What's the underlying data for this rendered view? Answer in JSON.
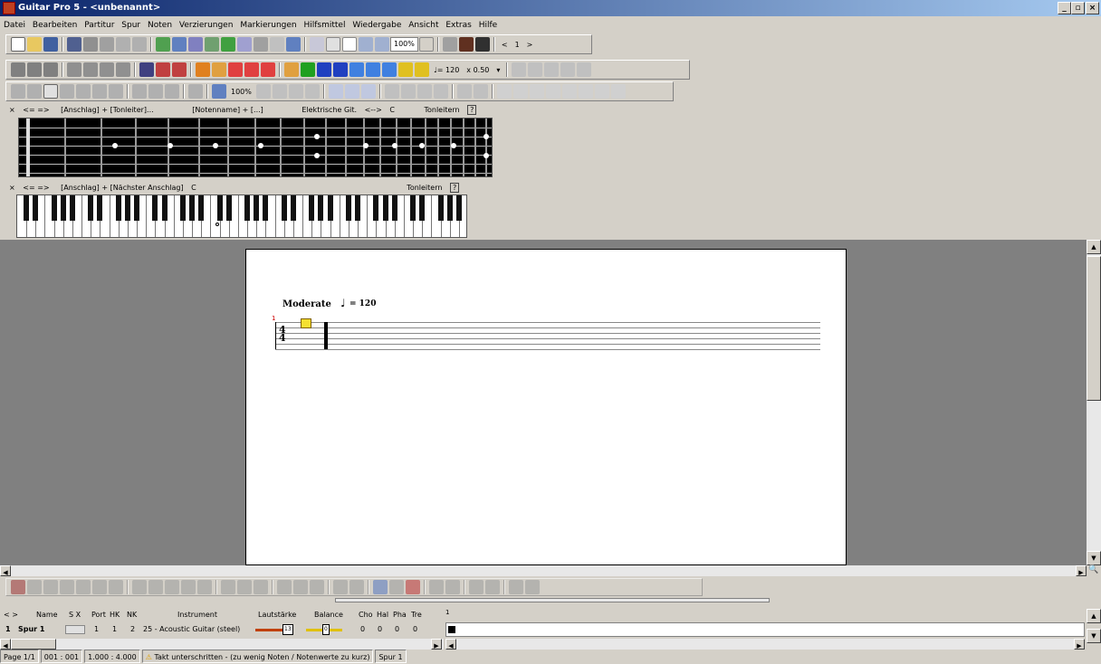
{
  "window": {
    "title": "Guitar Pro 5 - <unbenannt>",
    "min": "_",
    "max": "▫",
    "close": "×"
  },
  "menu": [
    "Datei",
    "Bearbeiten",
    "Partitur",
    "Spur",
    "Noten",
    "Verzierungen",
    "Markierungen",
    "Hilfsmittel",
    "Wiedergabe",
    "Ansicht",
    "Extras",
    "Hilfe"
  ],
  "toolbar1": {
    "zoom": "100%",
    "page": "1"
  },
  "toolbar2": {
    "tempo": "♩= 120",
    "speed": "x 0.50"
  },
  "toolbar3": {
    "volume": "100%"
  },
  "fretboard_panel": {
    "close": "×",
    "nav": "<= =>",
    "mode1": "[Anschlag] + [Tonleiter]...",
    "mode2": "[Notenname] + [...]",
    "instrument": "Elektrische Git.",
    "arrows": "<-->",
    "key": "C",
    "scales": "Tonleitern",
    "help": "?"
  },
  "keyboard_panel": {
    "close": "×",
    "nav": "<= =>",
    "mode": "[Anschlag] + [Nächster Anschlag]",
    "key": "C",
    "scales": "Tonleitern",
    "help": "?"
  },
  "score": {
    "tempo_text": "Moderate",
    "tempo_value": "= 120",
    "measure_num": "1",
    "time_sig_top": "4",
    "time_sig_bottom": "4"
  },
  "track_header": [
    "Name",
    "S X",
    "Port",
    "HK",
    "NK",
    "Instrument",
    "Lautstärke",
    "Balance",
    "Cho",
    "Hal",
    "Pha",
    "Tre"
  ],
  "track_row": {
    "num": "1",
    "name": "Spur 1",
    "port": "1",
    "hk": "1",
    "nk": "2",
    "instrument": "25 - Acoustic Guitar (steel)",
    "volume": "13",
    "balance": "0",
    "cho": "0",
    "hal": "0",
    "pha": "0",
    "tre": "0"
  },
  "timeline": {
    "measure": "1"
  },
  "status": {
    "page": "Page 1/1",
    "pos": "001 : 001",
    "time": "1.000 : 4.000",
    "warning": "Takt unterschritten - (zu wenig Noten / Notenwerte zu kurz)",
    "track": "Spur 1"
  }
}
